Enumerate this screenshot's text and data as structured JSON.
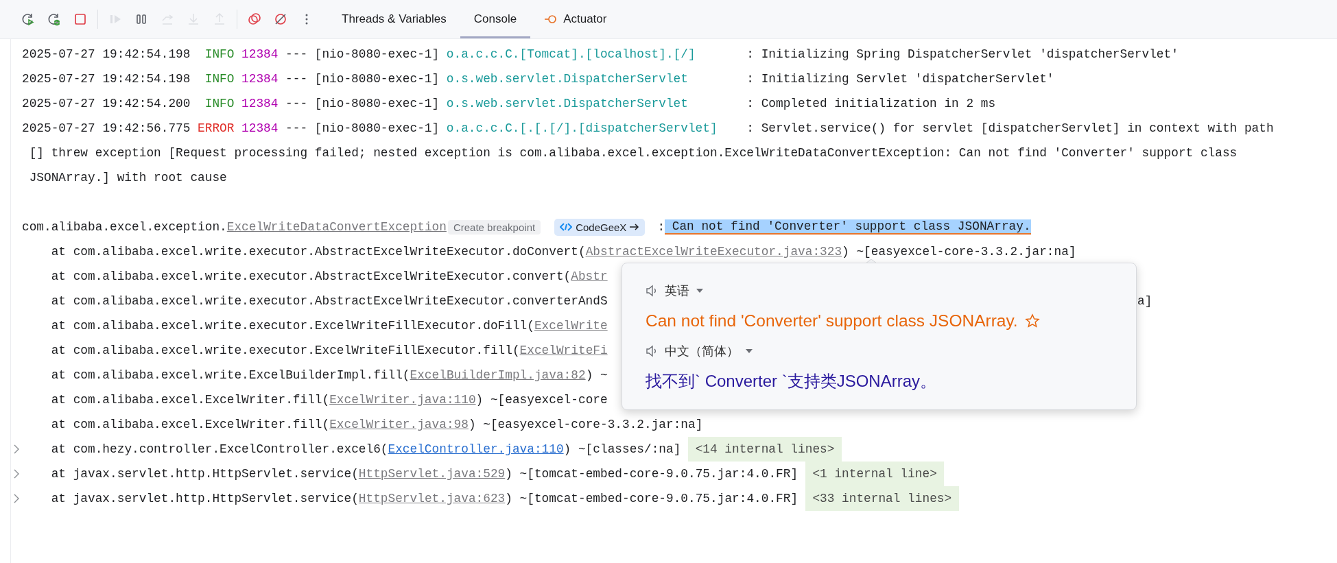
{
  "toolbar": {
    "buttons": [
      {
        "kind": "rerun",
        "disabled": false
      },
      {
        "kind": "rerun-debug",
        "disabled": false
      },
      {
        "kind": "stop",
        "disabled": false
      },
      {
        "kind": "separator",
        "disabled": false
      },
      {
        "kind": "resume",
        "disabled": true
      },
      {
        "kind": "pause",
        "disabled": false
      },
      {
        "kind": "step-over",
        "disabled": true
      },
      {
        "kind": "step-into",
        "disabled": true
      },
      {
        "kind": "step-out",
        "disabled": true
      },
      {
        "kind": "separator",
        "disabled": false
      },
      {
        "kind": "breakpoints",
        "disabled": false
      },
      {
        "kind": "mute-breakpoints",
        "disabled": false
      },
      {
        "kind": "more",
        "disabled": false
      }
    ],
    "tabs": [
      {
        "label": "Threads & Variables",
        "selected": false,
        "kind": "plain"
      },
      {
        "label": "Console",
        "selected": true,
        "kind": "plain"
      },
      {
        "label": "Actuator",
        "selected": false,
        "kind": "actuator"
      }
    ]
  },
  "log_entries": [
    {
      "timestamp": "2025-07-27 19:42:54.198",
      "level": "INFO",
      "pid": "12384",
      "separator": "---",
      "thread": "[nio-8080-exec-1]",
      "logger": "o.a.c.c.C.[Tomcat].[localhost].[/]",
      "message": ": Initializing Spring DispatcherServlet 'dispatcherServlet'"
    },
    {
      "timestamp": "2025-07-27 19:42:54.198",
      "level": "INFO",
      "pid": "12384",
      "separator": "---",
      "thread": "[nio-8080-exec-1]",
      "logger": "o.s.web.servlet.DispatcherServlet",
      "message": ": Initializing Servlet 'dispatcherServlet'"
    },
    {
      "timestamp": "2025-07-27 19:42:54.200",
      "level": "INFO",
      "pid": "12384",
      "separator": "---",
      "thread": "[nio-8080-exec-1]",
      "logger": "o.s.web.servlet.DispatcherServlet",
      "message": ": Completed initialization in 2 ms"
    },
    {
      "timestamp": "2025-07-27 19:42:56.775",
      "level": "ERROR",
      "pid": "12384",
      "separator": "---",
      "thread": "[nio-8080-exec-1]",
      "logger": "o.a.c.c.C.[.[.[/].[dispatcherServlet]",
      "message": ": Servlet.service() for servlet [dispatcherServlet] in context with path"
    }
  ],
  "message_continuation": [
    "[] threw exception [Request processing failed; nested exception is com.alibaba.excel.exception.ExcelWriteDataConvertException: Can not find 'Converter' support class",
    "JSONArray.] with root cause"
  ],
  "exception": {
    "package": "com.alibaba.excel.exception.",
    "class_link": "ExcelWriteDataConvertException",
    "inlay_hint": "Create breakpoint",
    "assistant_button": "CodeGeeX",
    "separator": ":",
    "selected_text": " Can not find 'Converter' support class JSONArray."
  },
  "stack": [
    {
      "text": "at com.alibaba.excel.write.executor.AbstractExcelWriteExecutor.doConvert(",
      "link": "AbstractExcelWriteExecutor.java:323",
      "kind": "library",
      "suffix": ") ~[easyexcel-core-3.3.2.jar:na]",
      "foldable": false
    },
    {
      "text": "at com.alibaba.excel.write.executor.AbstractExcelWriteExecutor.convert(",
      "link": "Abstr",
      "kind": "library",
      "foldable": false
    },
    {
      "text": "at com.alibaba.excel.write.executor.AbstractExcelWriteExecutor.converterAndS",
      "tail": "a]",
      "foldable": false
    },
    {
      "text": "at com.alibaba.excel.write.executor.ExcelWriteFillExecutor.doFill(",
      "link": "ExcelWrite",
      "kind": "library",
      "foldable": false
    },
    {
      "text": "at com.alibaba.excel.write.executor.ExcelWriteFillExecutor.fill(",
      "link": "ExcelWriteFi",
      "kind": "library",
      "foldable": false
    },
    {
      "text": "at com.alibaba.excel.write.ExcelBuilderImpl.fill(",
      "link": "ExcelBuilderImpl.java:82",
      "kind": "library",
      "suffix": ") ~",
      "foldable": false
    },
    {
      "text": "at com.alibaba.excel.ExcelWriter.fill(",
      "link": "ExcelWriter.java:110",
      "kind": "library",
      "suffix": ") ~[easyexcel-core",
      "foldable": false
    },
    {
      "text": "at com.alibaba.excel.ExcelWriter.fill(",
      "link": "ExcelWriter.java:98",
      "kind": "library",
      "suffix": ") ~[easyexcel-core-3.3.2.jar:na]",
      "foldable": false
    },
    {
      "text": "at com.hezy.controller.ExcelController.excel6(",
      "link": "ExcelController.java:110",
      "kind": "project",
      "suffix": ") ~[classes/:na]",
      "internal_lines": "<14 internal lines>",
      "foldable": true
    },
    {
      "text": "at javax.servlet.http.HttpServlet.service(",
      "link": "HttpServlet.java:529",
      "kind": "library",
      "suffix": ") ~[tomcat-embed-core-9.0.75.jar:4.0.FR]",
      "internal_lines": "<1 internal line>",
      "foldable": true
    },
    {
      "text": "at javax.servlet.http.HttpServlet.service(",
      "link": "HttpServlet.java:623",
      "kind": "library",
      "suffix": ") ~[tomcat-embed-core-9.0.75.jar:4.0.FR]",
      "internal_lines": "<33 internal lines>",
      "foldable": true
    }
  ],
  "translation_popup": {
    "source_language": "英语",
    "source_text": "Can not find 'Converter' support class JSONArray.",
    "favorited": false,
    "target_language": "中文（简体）",
    "target_text": "找不到` Converter `支持类JSONArray。"
  }
}
